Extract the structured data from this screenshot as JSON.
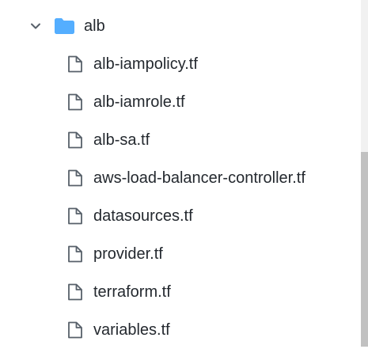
{
  "folder": {
    "name": "alb",
    "expanded": true,
    "chevron_icon": "chevron-down-icon",
    "folder_icon": "folder-icon",
    "folder_color": "#54aeff"
  },
  "files": [
    {
      "name": "alb-iampolicy.tf",
      "icon": "file-icon"
    },
    {
      "name": "alb-iamrole.tf",
      "icon": "file-icon"
    },
    {
      "name": "alb-sa.tf",
      "icon": "file-icon"
    },
    {
      "name": "aws-load-balancer-controller.tf",
      "icon": "file-icon"
    },
    {
      "name": "datasources.tf",
      "icon": "file-icon"
    },
    {
      "name": "provider.tf",
      "icon": "file-icon"
    },
    {
      "name": "terraform.tf",
      "icon": "file-icon"
    },
    {
      "name": "variables.tf",
      "icon": "file-icon"
    }
  ],
  "colors": {
    "text": "#24292f",
    "icon": "#57606a",
    "background": "#ffffff",
    "scrollbar_track": "#f1f1f1",
    "scrollbar_thumb": "#c1c1c1"
  }
}
